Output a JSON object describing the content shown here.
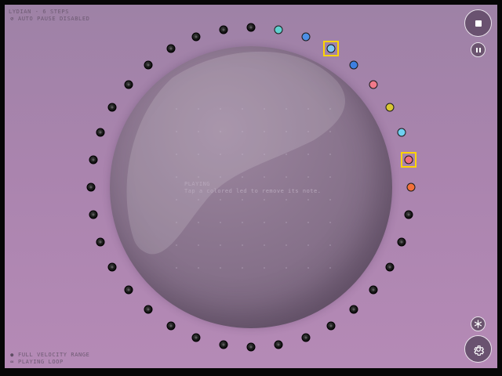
{
  "status": {
    "top_line1": "LYDIAN - 6 STEPS",
    "top_line2": "AUTO PAUSE DISABLED",
    "bottom_line1": "FULL VELOCITY RANGE",
    "bottom_line2": "PLAYING LOOP"
  },
  "center": {
    "title": "PLAYING",
    "hint": "Tap a colored led to remove its  note."
  },
  "colors": {
    "selection": "#ffd400",
    "empty_led": "#111111"
  },
  "ring": {
    "led_count": 36,
    "colored_leds": [
      {
        "index": 1,
        "color": "#5fd1cf",
        "selected": false
      },
      {
        "index": 2,
        "color": "#4d8fe6",
        "selected": false
      },
      {
        "index": 3,
        "color": "#7ec8f2",
        "selected": true
      },
      {
        "index": 4,
        "color": "#3d7fe0",
        "selected": false
      },
      {
        "index": 5,
        "color": "#f07a8a",
        "selected": false
      },
      {
        "index": 6,
        "color": "#d9c733",
        "selected": false
      },
      {
        "index": 7,
        "color": "#6fd0f0",
        "selected": false
      },
      {
        "index": 8,
        "color": "#ee6f7e",
        "selected": true
      },
      {
        "index": 9,
        "color": "#f2703a",
        "selected": false
      }
    ]
  },
  "icons": {
    "stop": "stop-icon",
    "pause": "pause-icon",
    "mode": "snowflake-icon",
    "settings": "gear-icon"
  }
}
